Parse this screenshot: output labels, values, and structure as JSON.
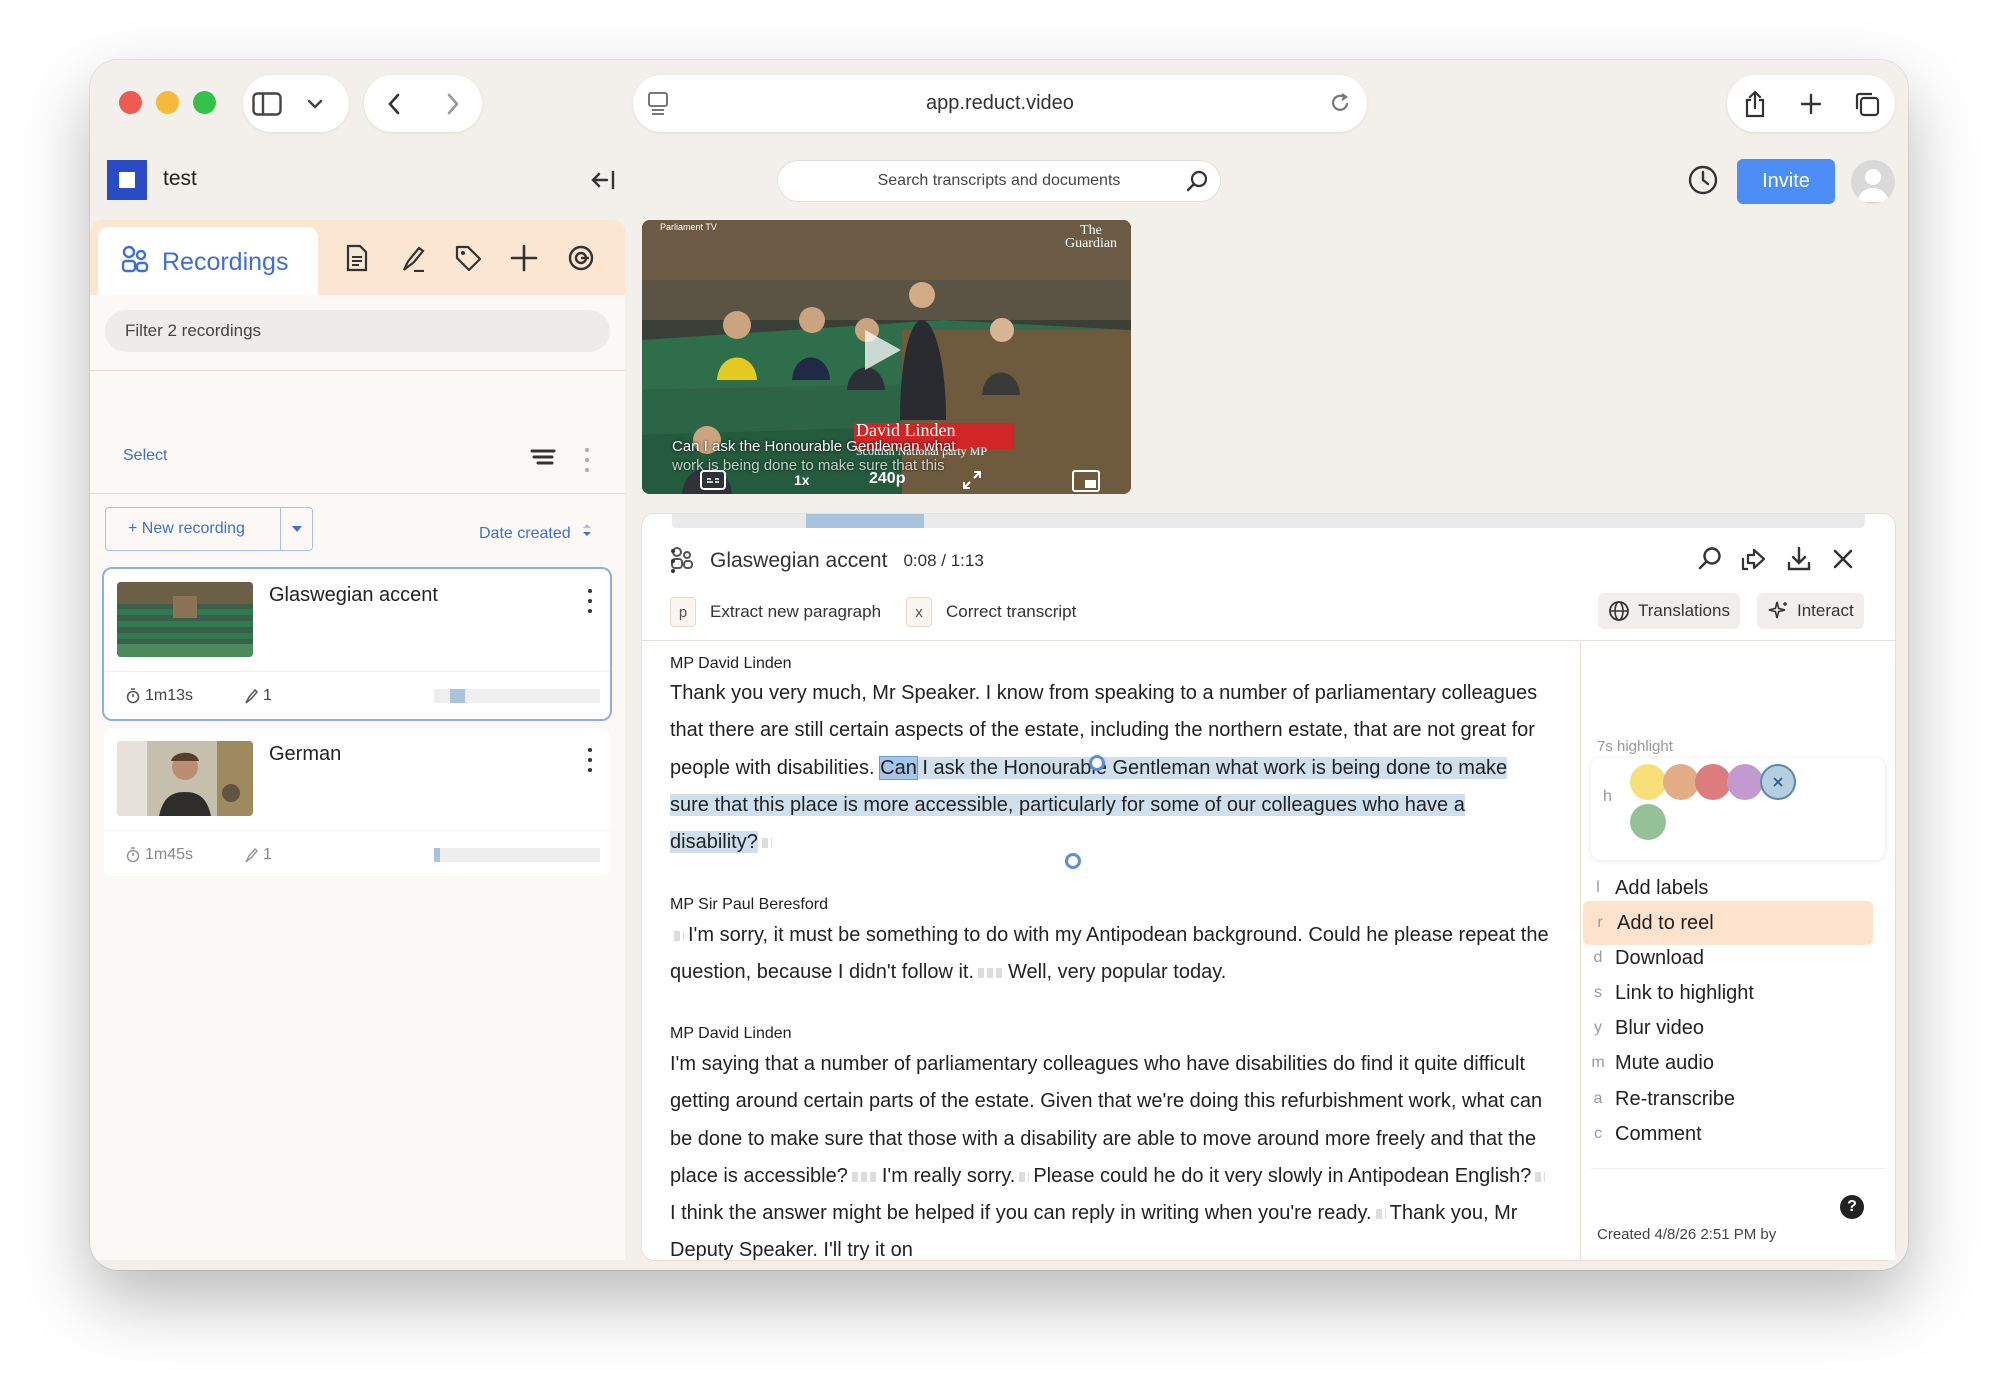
{
  "browser": {
    "url": "app.reduct.video"
  },
  "app": {
    "project": "test",
    "search_placeholder": "Search transcripts and documents",
    "invite_label": "Invite"
  },
  "sidebar": {
    "active_tab": "Recordings",
    "filter_placeholder": "Filter 2 recordings",
    "select_label": "Select",
    "new_recording_label": "+ New recording",
    "sort_label": "Date created",
    "recordings": [
      {
        "title": "Glaswegian accent",
        "duration": "1m13s",
        "highlights": "1",
        "progress": 0.1
      },
      {
        "title": "German",
        "duration": "1m45s",
        "highlights": "1",
        "progress": 0.02
      }
    ]
  },
  "video": {
    "caption_line1": "Can I ask the Honourable Gentleman what",
    "caption_line2": "work is being done to make sure that this",
    "lower_third_name": "David Linden",
    "lower_third_party": "Scottish National party MP",
    "quality": "240p",
    "channel": "Parliament TV",
    "brand": "The Guardian"
  },
  "transcript": {
    "title": "Glaswegian accent",
    "time": "0:08 / 1:13",
    "playback_progress": 0.11,
    "suggestions": [
      {
        "key": "p",
        "label": "Extract new paragraph"
      },
      {
        "key": "x",
        "label": "Correct transcript"
      }
    ],
    "translations_label": "Translations",
    "interact_label": "Interact",
    "blocks": [
      {
        "speaker": "MP David Linden",
        "pre": "Thank you very much, Mr Speaker. I know from speaking to a number of parliamentary colleagues that there are still certain aspects of the estate, including the northern estate, that are not great for people with disabilities.",
        "highlight_word": "Can",
        "highlight": " I ask the Honourable Gentleman what work is being done to make sure that this place is more accessible, particularly for some of our colleagues who have a disability?"
      },
      {
        "speaker": "MP Sir Paul Beresford",
        "text1": "I'm sorry, it must be something to do with my Antipodean background. Could he please repeat the question, because I didn't follow it.",
        "text2": "Well, very popular today."
      },
      {
        "speaker": "MP David Linden",
        "text1": "I'm saying that a number of parliamentary colleagues who have disabilities do find it quite difficult getting around certain parts of the estate. Given that we're doing this refurbishment work, what can be done to make sure that those with a disability are able to move around more freely and that the place is accessible?",
        "text2": "I'm really sorry.",
        "text3": "Please could he do it very slowly in Antipodean English?",
        "text4": "I think the answer might be helped if you can reply in writing when you're ready.",
        "text5": "Thank you, Mr Deputy Speaker. I'll try it on"
      }
    ]
  },
  "highlight_menu": {
    "header": "7s highlight",
    "color_key": "h",
    "colors": [
      "#f7df7a",
      "#e3ae86",
      "#dd7c7c",
      "#c39ad0",
      "#b6cfe0",
      "#94c196"
    ],
    "items": [
      {
        "key": "l",
        "label": "Add labels"
      },
      {
        "key": "r",
        "label": "Add to reel"
      },
      {
        "key": "d",
        "label": "Download"
      },
      {
        "key": "s",
        "label": "Link to highlight"
      },
      {
        "key": "y",
        "label": "Blur video"
      },
      {
        "key": "m",
        "label": "Mute audio"
      },
      {
        "key": "a",
        "label": "Re-transcribe"
      },
      {
        "key": "c",
        "label": "Comment"
      }
    ],
    "created": "Created 4/8/26 2:51 PM by",
    "help": "?"
  }
}
